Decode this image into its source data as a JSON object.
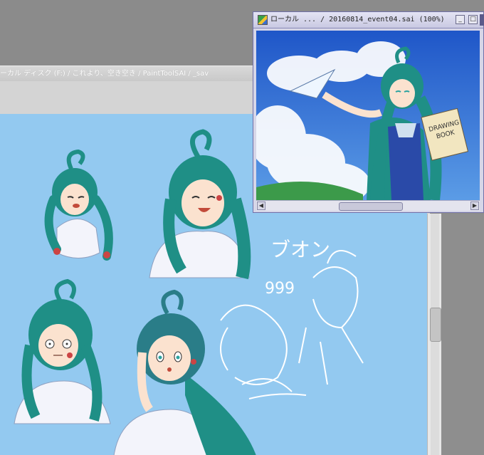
{
  "main_window": {
    "path_title": "ーカル ディスク (F:) / これより、空き空き / PaintToolSAI / _sav"
  },
  "preview_window": {
    "title": "ローカル ... / 20160814_event04.sai (100%)",
    "minimize_glyph": "_",
    "maximize_glyph": "□"
  },
  "artwork": {
    "sketch_text_1": "ブオン",
    "sketch_text_2": "999",
    "book_text_line1": "DRAWING",
    "book_text_line2": "BOOK"
  },
  "scrollbar": {
    "left_arrow": "◀",
    "right_arrow": "▶"
  },
  "colors": {
    "canvas_bg": "#93c9f0",
    "hair": "#1f8f86",
    "sky": "#2f6ed0"
  }
}
